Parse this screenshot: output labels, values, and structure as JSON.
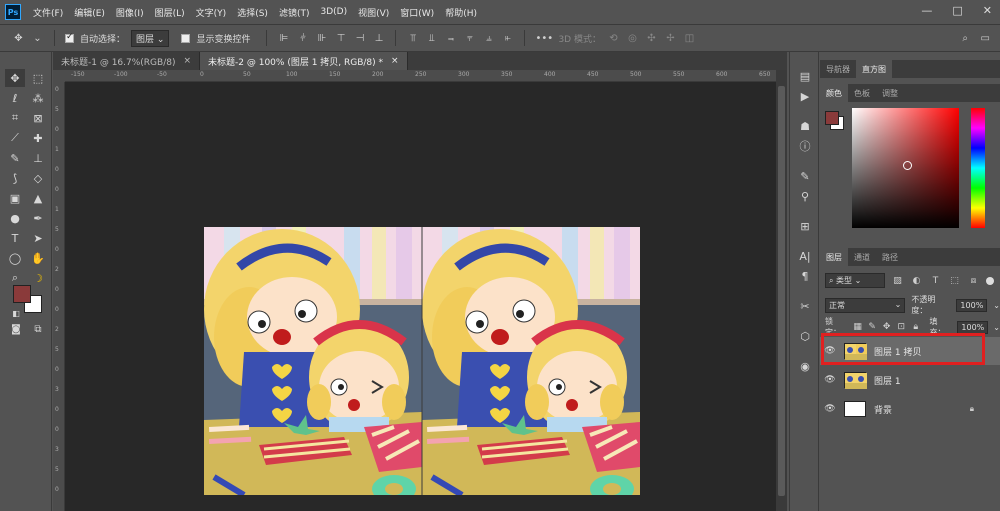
{
  "app": {
    "logo": "Ps"
  },
  "menu": [
    "文件(F)",
    "编辑(E)",
    "图像(I)",
    "图层(L)",
    "文字(Y)",
    "选择(S)",
    "滤镜(T)",
    "3D(D)",
    "视图(V)",
    "窗口(W)",
    "帮助(H)"
  ],
  "window_controls": {
    "minimize": "—",
    "restore": "□",
    "close": "✕"
  },
  "options": {
    "auto_select_label": "自动选择：",
    "auto_select_checked": true,
    "auto_select_value": "图层",
    "show_transform_label": "显示变换控件",
    "mode_3d_label": "3D 模式："
  },
  "tabs": [
    {
      "label": "未标题-1 @ 16.7%(RGB/8)",
      "close": "×"
    },
    {
      "label": "未标题-2 @ 100% (图层 1 拷贝, RGB/8) *",
      "close": "×"
    }
  ],
  "ruler_top": [
    "-150",
    "-100",
    "-50",
    "0",
    "50",
    "100",
    "150",
    "200",
    "250",
    "300",
    "350",
    "400",
    "450",
    "500",
    "550",
    "600",
    "650"
  ],
  "ruler_left": [
    "0",
    "5",
    "0",
    "1",
    "0",
    "0",
    "1",
    "5",
    "0",
    "2",
    "0",
    "0",
    "2",
    "5",
    "0",
    "3",
    "0",
    "0",
    "3",
    "5",
    "0"
  ],
  "colors": {
    "foreground": "#8a3a3a",
    "background": "#ffffff",
    "accent_highlight": "#e02020"
  },
  "panels": {
    "top_tabs": [
      "导航器",
      "直方图"
    ],
    "color_tabs": [
      "颜色",
      "色板",
      "调整"
    ],
    "layers_tabs": [
      "图层",
      "通道",
      "路径"
    ],
    "filter_kind": "类型",
    "blend_mode": "正常",
    "opacity_label": "不透明度：",
    "opacity_value": "100%",
    "lock_label": "锁定：",
    "fill_label": "填充：",
    "fill_value": "100%"
  },
  "layers": [
    {
      "name": "图层 1 拷贝",
      "selected": true
    },
    {
      "name": "图层 1",
      "selected": false
    },
    {
      "name": "背景",
      "selected": false,
      "locked": true
    }
  ]
}
